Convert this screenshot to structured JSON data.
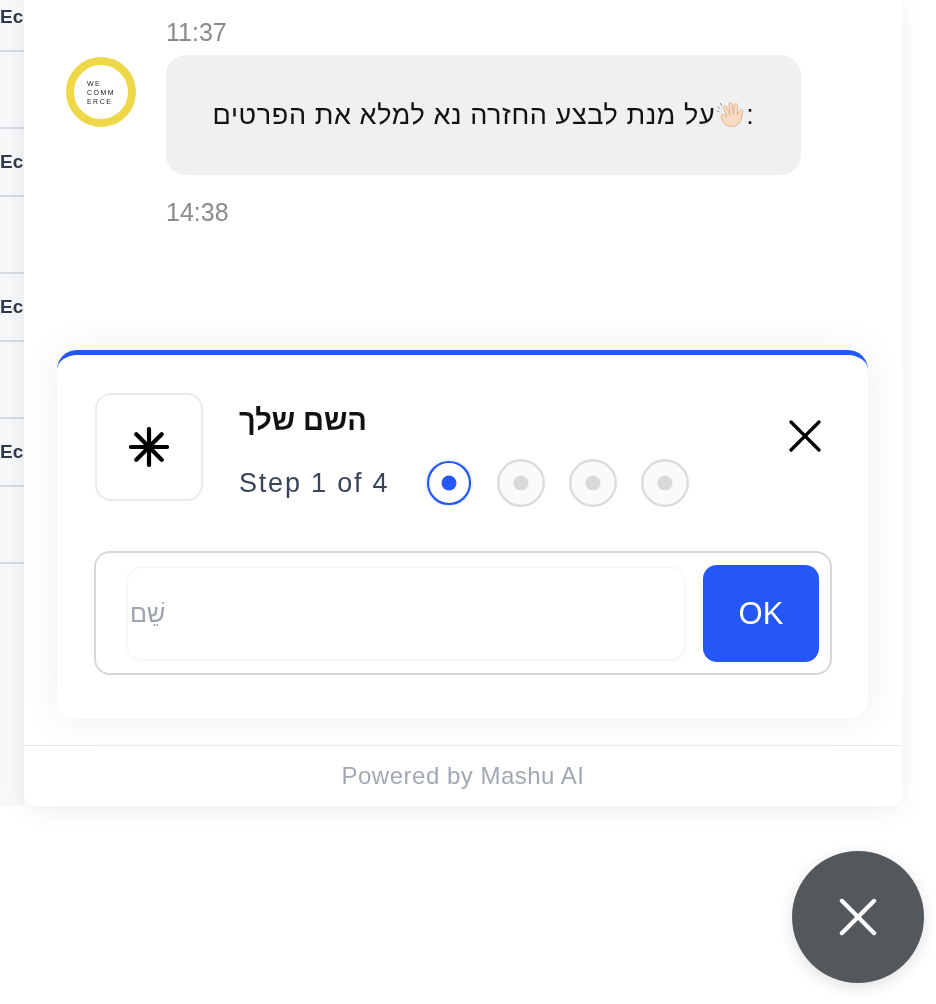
{
  "background_list": {
    "items": [
      "Ec",
      "Ec",
      "Ec",
      "Ec"
    ]
  },
  "chat": {
    "items": [
      {
        "kind": "time",
        "text": "11:37"
      },
      {
        "kind": "message",
        "avatar": {
          "logo_text": [
            "WE",
            "COMM",
            "ERCE"
          ]
        },
        "text": "על מנת לבצע החזרה נא למלא את הפרטים",
        "suffix": ":"
      },
      {
        "kind": "time",
        "text": "14:38"
      }
    ]
  },
  "form": {
    "title": "השם שלך",
    "step_label": "Step 1 of 4",
    "steps": [
      {
        "selected": true
      },
      {
        "selected": false
      },
      {
        "selected": false
      },
      {
        "selected": false
      }
    ],
    "input": {
      "placeholder": "שֵׁם"
    },
    "submit": "OK"
  },
  "footer": {
    "text": "Powered by Mashu AI"
  }
}
